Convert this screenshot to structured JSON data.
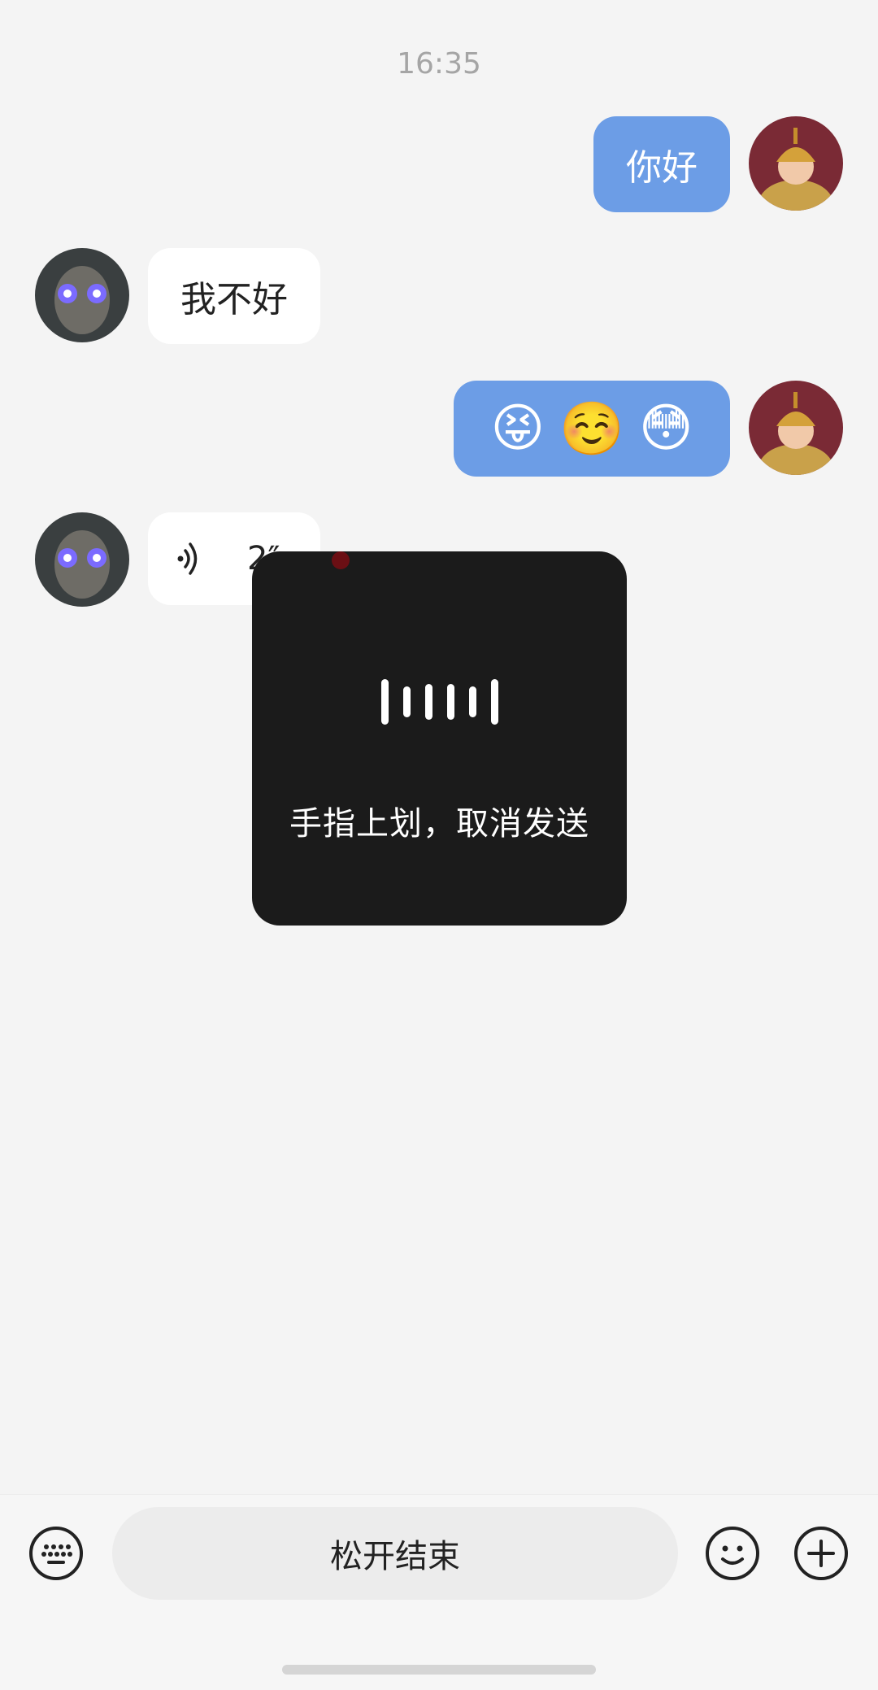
{
  "chat": {
    "timestamp": "16:35",
    "messages": [
      {
        "side": "out",
        "type": "text",
        "text": "你好"
      },
      {
        "side": "in",
        "type": "text",
        "text": "我不好"
      },
      {
        "side": "out",
        "type": "emoji",
        "emojis": [
          "😝",
          "☺️",
          "😳"
        ]
      },
      {
        "side": "in",
        "type": "voice",
        "duration": "2″"
      }
    ]
  },
  "overlay": {
    "hint": "手指上划，取消发送"
  },
  "input_bar": {
    "hold_button_label": "松开结束",
    "left_icon": "keyboard-icon",
    "emoji_icon": "smiley-icon",
    "plus_icon": "plus-circle-icon"
  },
  "colors": {
    "outgoing_bubble": "#6c9de6",
    "incoming_bubble": "#ffffff",
    "background": "#f4f4f4",
    "overlay": "#1b1b1b"
  }
}
